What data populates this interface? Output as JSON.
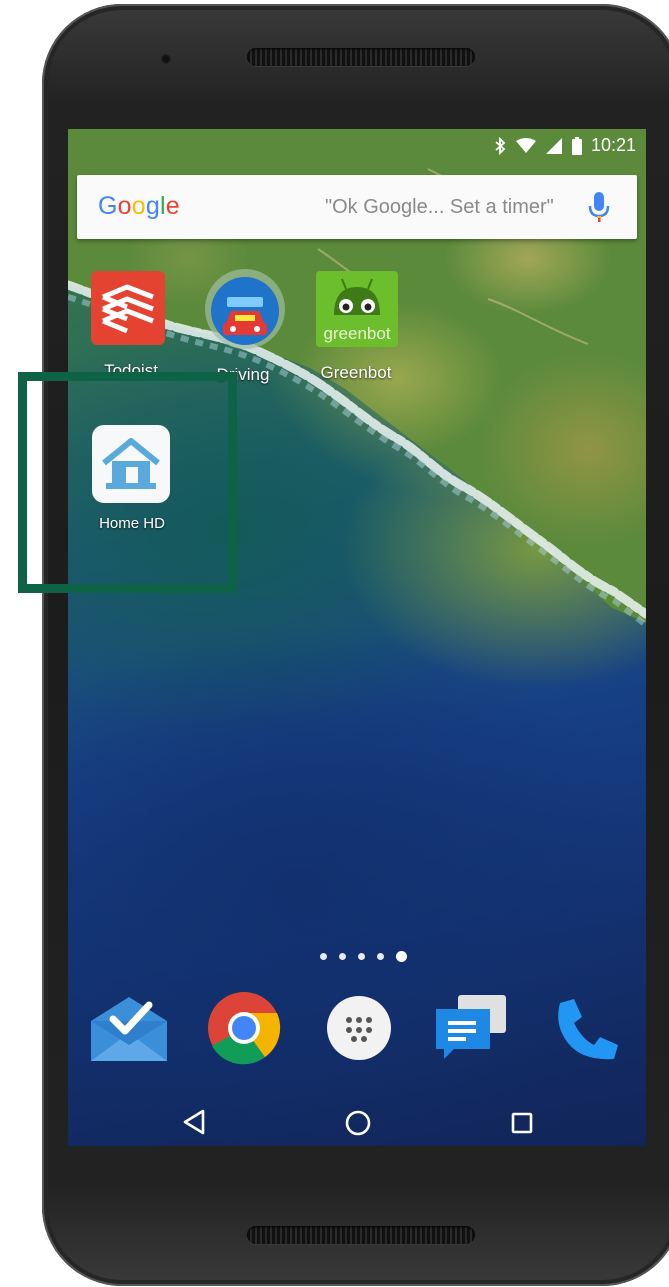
{
  "status_bar": {
    "time": "10:21",
    "icons": [
      "bluetooth-icon",
      "wifi-icon",
      "signal-icon",
      "battery-icon"
    ]
  },
  "search_widget": {
    "logo": "Google",
    "hint": "\"Ok Google... Set a timer\"",
    "mic_icon": "mic-icon"
  },
  "home_apps": [
    {
      "label": "Todoist",
      "icon": "todoist-icon"
    },
    {
      "label": "Driving",
      "icon": "driving-icon"
    },
    {
      "label": "Greenbot",
      "icon": "greenbot-icon"
    },
    {
      "label": "Home HD",
      "icon": "home-hd-icon"
    }
  ],
  "page_indicator": {
    "pages": 5,
    "current": 5
  },
  "dock": [
    {
      "icon": "inbox-icon"
    },
    {
      "icon": "chrome-icon"
    },
    {
      "icon": "app-drawer-icon"
    },
    {
      "icon": "messenger-icon"
    },
    {
      "icon": "phone-icon"
    }
  ],
  "nav_bar": [
    "back-icon",
    "home-icon",
    "recents-icon"
  ],
  "colors": {
    "highlight": "#0e6246",
    "greenbot": "#6cbe2d",
    "todoist": "#e44332"
  }
}
